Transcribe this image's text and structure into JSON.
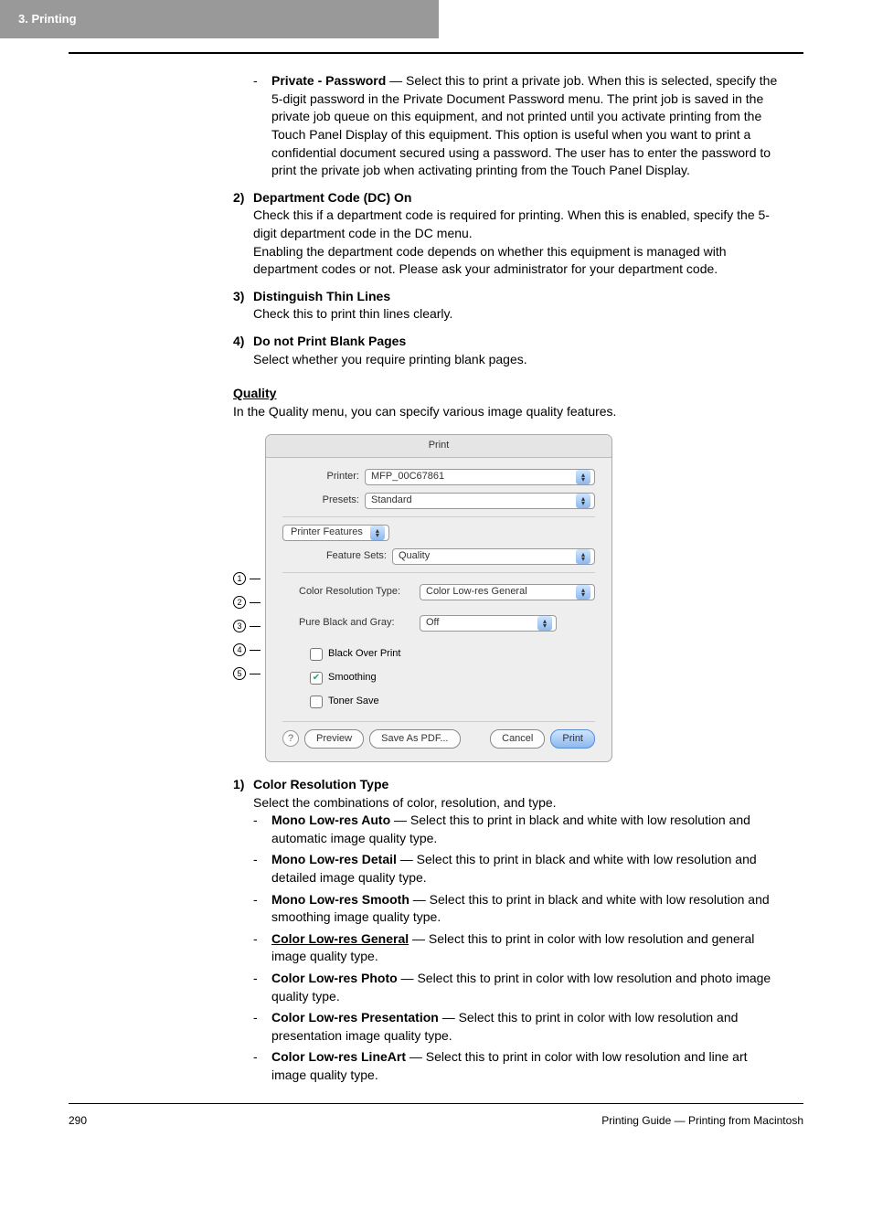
{
  "header": {
    "chapter": "3.  Printing"
  },
  "private_password": {
    "label": "Private - Password",
    "text": " — Select this to print a private job.   When this is selected, specify the 5-digit password in the Private Document Password menu.  The print job is saved in the private job queue on this equipment, and not printed until you activate printing from the Touch Panel Display of this equipment.  This option is useful when you want to print a confidential document secured using a password.  The user has to enter the password to print the private job when activating printing from the Touch Panel Display."
  },
  "item2": {
    "num": "2)",
    "title": "Department Code (DC) On",
    "p1": "Check this if a department code is required for printing. When this is enabled, specify the 5-digit department code in the DC menu.",
    "p2": "Enabling the department code depends on whether this equipment is managed with department codes or not.  Please ask your administrator for your department code."
  },
  "item3": {
    "num": "3)",
    "title": "Distinguish Thin Lines",
    "p1": "Check this to print thin lines clearly."
  },
  "item4": {
    "num": "4)",
    "title": "Do not Print Blank Pages",
    "p1": "Select whether you require printing blank pages."
  },
  "quality": {
    "title": "Quality",
    "intro": "In the Quality menu, you can specify various image quality features."
  },
  "dialog": {
    "title": "Print",
    "printer_label": "Printer:",
    "printer_value": "MFP_00C67861",
    "presets_label": "Presets:",
    "presets_value": "Standard",
    "feature_tab": "Printer Features",
    "feature_sets_label": "Feature Sets:",
    "feature_sets_value": "Quality",
    "opt1_label": "Color Resolution Type:",
    "opt1_value": "Color Low-res General",
    "opt2_label": "Pure Black and Gray:",
    "opt2_value": "Off",
    "chk1": "Black Over Print",
    "chk2": "Smoothing",
    "chk3": "Toner Save",
    "btn_preview": "Preview",
    "btn_save": "Save As PDF...",
    "btn_cancel": "Cancel",
    "btn_print": "Print",
    "help": "?"
  },
  "callouts": {
    "n1": "1",
    "n2": "2",
    "n3": "3",
    "n4": "4",
    "n5": "5"
  },
  "colorres": {
    "num": "1)",
    "title": "Color Resolution Type",
    "intro": "Select the combinations of color, resolution, and type.",
    "opts": [
      {
        "name": "Mono Low-res Auto",
        "desc": " — Select this to print in black and white with low resolution and automatic image quality type.",
        "underline": false
      },
      {
        "name": "Mono Low-res Detail",
        "desc": " — Select this to print in black and white with low resolution and detailed image quality type.",
        "underline": false
      },
      {
        "name": "Mono Low-res Smooth",
        "desc": " — Select this to print in black and white with low resolution and smoothing image quality type.",
        "underline": false
      },
      {
        "name": "Color Low-res General",
        "desc": " — Select this to print in color with low resolution and general image quality type.",
        "underline": true
      },
      {
        "name": "Color Low-res Photo",
        "desc": " — Select this to print in color with low resolution and photo image quality type.",
        "underline": false
      },
      {
        "name": "Color Low-res Presentation",
        "desc": " — Select this to print in color with low resolution and presentation image quality type.",
        "underline": false
      },
      {
        "name": "Color Low-res LineArt",
        "desc": " — Select this to print in color with low resolution and line art image quality type.",
        "underline": false
      }
    ]
  },
  "footer": {
    "page": "290",
    "title": "Printing Guide — Printing from Macintosh"
  }
}
